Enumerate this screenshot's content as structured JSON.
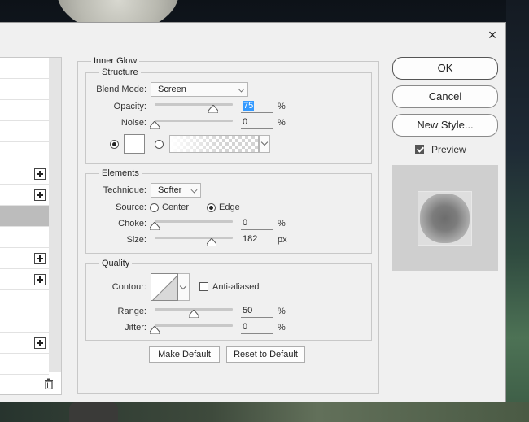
{
  "dialog": {
    "section_title": "Inner Glow",
    "close_glyph": "×"
  },
  "structure": {
    "title": "Structure",
    "blend_mode_label": "Blend Mode:",
    "blend_mode_value": "Screen",
    "opacity_label": "Opacity:",
    "opacity_value": "75",
    "opacity_fraction": 0.75,
    "noise_label": "Noise:",
    "noise_value": "0",
    "noise_fraction": 0.0,
    "percent": "%",
    "glow_color": "#ffffff"
  },
  "elements": {
    "title": "Elements",
    "technique_label": "Technique:",
    "technique_value": "Softer",
    "source_label": "Source:",
    "source_center": "Center",
    "source_edge": "Edge",
    "choke_label": "Choke:",
    "choke_value": "0",
    "choke_fraction": 0.0,
    "size_label": "Size:",
    "size_value": "182",
    "size_fraction": 0.73,
    "percent": "%",
    "px": "px"
  },
  "quality": {
    "title": "Quality",
    "contour_label": "Contour:",
    "anti_aliased_label": "Anti-aliased",
    "range_label": "Range:",
    "range_value": "50",
    "range_fraction": 0.5,
    "jitter_label": "Jitter:",
    "jitter_value": "0",
    "jitter_fraction": 0.0,
    "percent": "%"
  },
  "buttons": {
    "make_default": "Make Default",
    "reset_to_default": "Reset to Default",
    "ok": "OK",
    "cancel": "Cancel",
    "new_style": "New Style...",
    "preview_label": "Preview"
  },
  "icons": {
    "close": "close-icon",
    "plus": "plus-icon",
    "trash": "trash-icon",
    "checkmark": "checkmark-icon",
    "chevron": "chevron-down-icon"
  },
  "colors": {
    "selection": "#3399ff",
    "dialog_bg": "#f0f0f0",
    "selected_row": "#bcbcbc"
  }
}
